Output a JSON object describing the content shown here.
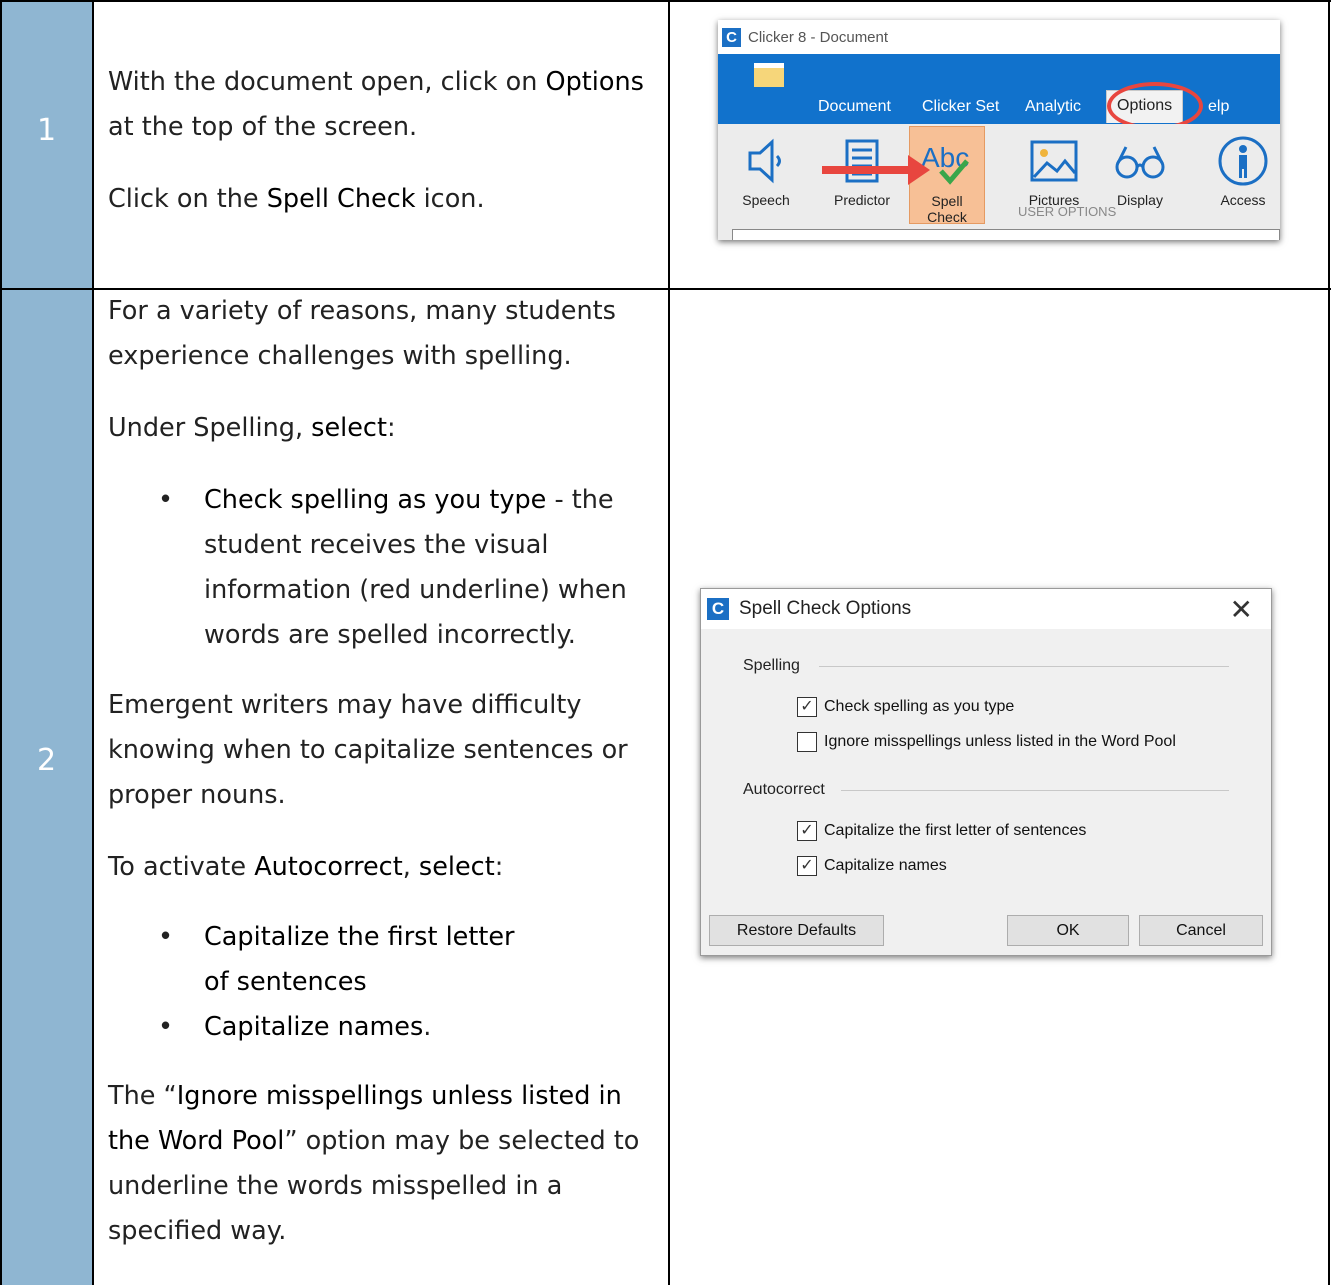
{
  "steps": [
    {
      "number": "1",
      "text": {
        "p1_pre": "With the document open, click on ",
        "p1_bold": "Options",
        "p1_post": " at the top of the screen.",
        "p2_pre": "Click on the ",
        "p2_bold": "Spell Check",
        "p2_post": " icon."
      }
    },
    {
      "number": "2",
      "text": {
        "p1": "For a variety of reasons, many students experience challenges with spelling.",
        "p2_pre": "Under Spelling, ",
        "p2_bold": "select",
        "p2_post": ":",
        "bullet1_bold": "Check spelling as you type",
        "bullet1_rest": " - the student receives the visual information (red underline) when words are spelled incorrectly.",
        "p3": "Emergent writers may have difficulty knowing when to capitalize sentences or proper nouns.",
        "p4_pre": "To activate ",
        "p4_bold1": "Autocorrect",
        "p4_mid": ", ",
        "p4_bold2": "select",
        "p4_post": ":",
        "bullet2": "Capitalize the first letter of sentences",
        "bullet3": "Capitalize names",
        "bullet3_post": ".",
        "p5_pre": "The “",
        "p5_bold": "Ignore misspellings unless listed in the Word Pool",
        "p5_post": "” option may be selected to underline the words misspelled in a specified way."
      }
    }
  ],
  "ribbon": {
    "logo": "C",
    "window_title": "Clicker 8 - Document",
    "tabs": [
      "Document",
      "Clicker Set",
      "Analytics",
      "Options",
      "Help"
    ],
    "tab_analytics_visible": "Analytic",
    "tab_help_visible": "elp",
    "tools": [
      "Speech",
      "Predictor",
      "Spell Check",
      "Pictures",
      "Display",
      "Access"
    ],
    "group_label": "USER OPTIONS",
    "icons": {
      "speech": "speaker-icon",
      "predictor": "list-icon",
      "spell_check": "abc-check-icon",
      "pictures": "picture-icon",
      "display": "glasses-icon",
      "access": "accessibility-icon"
    },
    "accent_colors": {
      "bar": "#1172cc",
      "highlight": "#f7c096",
      "annotation": "#e8463f"
    }
  },
  "dialog": {
    "logo": "C",
    "title": "Spell Check Options",
    "close": "✕",
    "spelling_label": "Spelling",
    "autocorrect_label": "Autocorrect",
    "options": [
      {
        "label": "Check spelling as you type",
        "checked": true
      },
      {
        "label": "Ignore misspellings unless listed in the Word Pool",
        "checked": false
      },
      {
        "label": "Capitalize the first letter of sentences",
        "checked": true
      },
      {
        "label": "Capitalize names",
        "checked": true
      }
    ],
    "check_mark": "✓",
    "buttons": {
      "restore": "Restore Defaults",
      "ok": "OK",
      "cancel": "Cancel"
    }
  }
}
